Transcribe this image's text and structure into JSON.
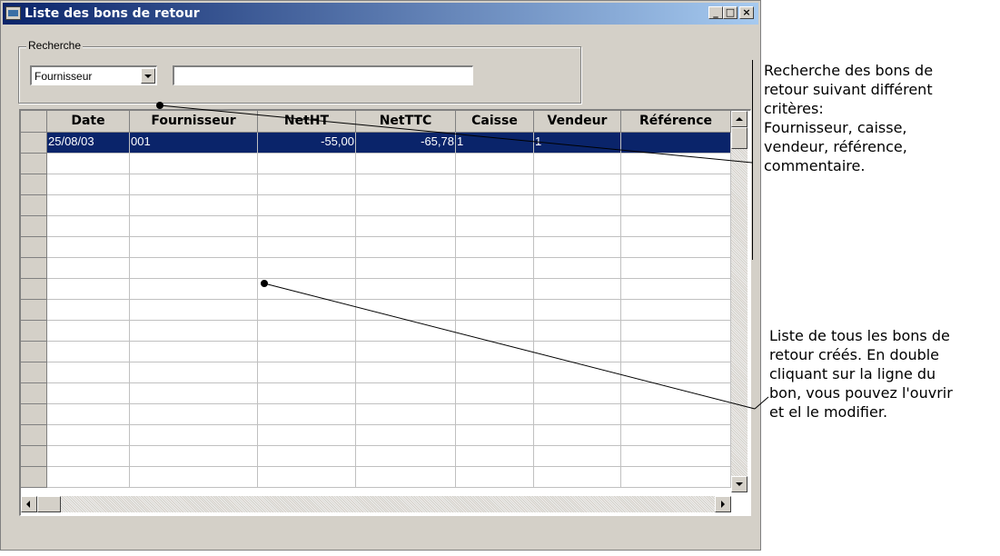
{
  "window": {
    "title": "Liste des bons de retour",
    "minimize_glyph": "_",
    "maximize_glyph": "□",
    "close_glyph": "×"
  },
  "search": {
    "group_label": "Recherche",
    "field_selected": "Fournisseur",
    "query_value": ""
  },
  "grid": {
    "columns": [
      "Date",
      "Fournisseur",
      "NetHT",
      "NetTTC",
      "Caisse",
      "Vendeur",
      "Référence"
    ],
    "rows": [
      [
        "25/08/03",
        "001",
        "-55,00",
        "-65,78",
        "1",
        "1",
        ""
      ]
    ],
    "selected_row": 0
  },
  "annotations": {
    "search_note": "Recherche des bons de\nretour suivant différent\ncritères:\nFournisseur, caisse,\nvendeur, référence,\ncommentaire.",
    "list_note": "Liste de tous les bons de\nretour créés. En double\ncliquant sur la ligne du\nbon, vous pouvez l'ouvrir\net el le modifier."
  },
  "colors": {
    "titlebar": "#0a246a",
    "selection": "#0a246a",
    "face": "#d4d0c8"
  }
}
